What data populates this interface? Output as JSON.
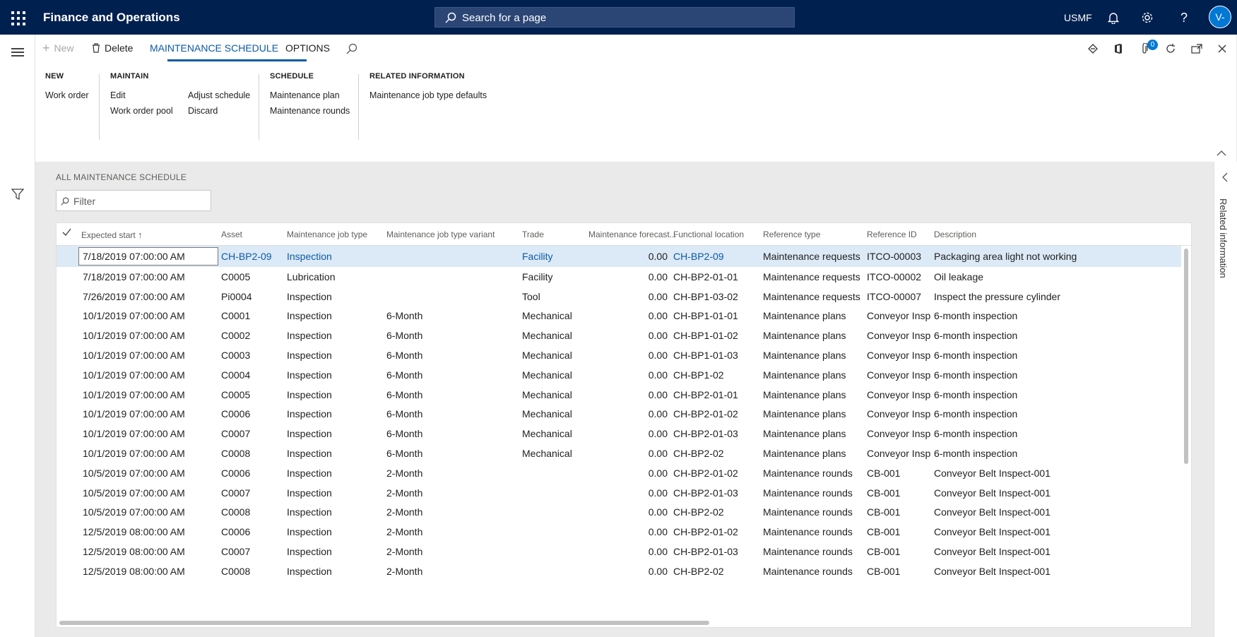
{
  "topbar": {
    "app_title": "Finance and Operations",
    "search_placeholder": "Search for a page",
    "company": "USMF",
    "avatar_initials": "V-"
  },
  "toolbar": {
    "new_label": "New",
    "delete_label": "Delete",
    "tabs": [
      {
        "label": "MAINTENANCE SCHEDULE",
        "active": true
      },
      {
        "label": "OPTIONS",
        "active": false
      }
    ],
    "notification_count": "0"
  },
  "ribbon": {
    "groups": [
      {
        "title": "NEW",
        "items": [
          "Work order"
        ]
      },
      {
        "title": "MAINTAIN",
        "items": [
          "Edit",
          "Work order pool",
          "Adjust schedule",
          "Discard"
        ]
      },
      {
        "title": "SCHEDULE",
        "items": [
          "Maintenance plan",
          "Maintenance rounds"
        ]
      },
      {
        "title": "RELATED INFORMATION",
        "items": [
          "Maintenance job type defaults"
        ]
      }
    ]
  },
  "page": {
    "title": "ALL MAINTENANCE SCHEDULE",
    "filter_placeholder": "Filter"
  },
  "grid": {
    "columns": [
      "Expected start",
      "Asset",
      "Maintenance job type",
      "Maintenance job type variant",
      "Trade",
      "Maintenance forecast...",
      "Functional location",
      "Reference type",
      "Reference ID",
      "Description"
    ],
    "rows": [
      [
        "7/18/2019 07:00:00 AM",
        "CH-BP2-09",
        "Inspection",
        "",
        "Facility",
        "0.00",
        "CH-BP2-09",
        "Maintenance requests",
        "ITCO-00003",
        "Packaging area light not working"
      ],
      [
        "7/18/2019 07:00:00 AM",
        "C0005",
        "Lubrication",
        "",
        "Facility",
        "0.00",
        "CH-BP2-01-01",
        "Maintenance requests",
        "ITCO-00002",
        "Oil leakage"
      ],
      [
        "7/26/2019 07:00:00 AM",
        "Pi0004",
        "Inspection",
        "",
        "Tool",
        "0.00",
        "CH-BP1-03-02",
        "Maintenance requests",
        "ITCO-00007",
        "Inspect the pressure cylinder"
      ],
      [
        "10/1/2019 07:00:00 AM",
        "C0001",
        "Inspection",
        "6-Month",
        "Mechanical",
        "0.00",
        "CH-BP1-01-01",
        "Maintenance plans",
        "Conveyor Insp",
        "6-month inspection"
      ],
      [
        "10/1/2019 07:00:00 AM",
        "C0002",
        "Inspection",
        "6-Month",
        "Mechanical",
        "0.00",
        "CH-BP1-01-02",
        "Maintenance plans",
        "Conveyor Insp",
        "6-month inspection"
      ],
      [
        "10/1/2019 07:00:00 AM",
        "C0003",
        "Inspection",
        "6-Month",
        "Mechanical",
        "0.00",
        "CH-BP1-01-03",
        "Maintenance plans",
        "Conveyor Insp",
        "6-month inspection"
      ],
      [
        "10/1/2019 07:00:00 AM",
        "C0004",
        "Inspection",
        "6-Month",
        "Mechanical",
        "0.00",
        "CH-BP1-02",
        "Maintenance plans",
        "Conveyor Insp",
        "6-month inspection"
      ],
      [
        "10/1/2019 07:00:00 AM",
        "C0005",
        "Inspection",
        "6-Month",
        "Mechanical",
        "0.00",
        "CH-BP2-01-01",
        "Maintenance plans",
        "Conveyor Insp",
        "6-month inspection"
      ],
      [
        "10/1/2019 07:00:00 AM",
        "C0006",
        "Inspection",
        "6-Month",
        "Mechanical",
        "0.00",
        "CH-BP2-01-02",
        "Maintenance plans",
        "Conveyor Insp",
        "6-month inspection"
      ],
      [
        "10/1/2019 07:00:00 AM",
        "C0007",
        "Inspection",
        "6-Month",
        "Mechanical",
        "0.00",
        "CH-BP2-01-03",
        "Maintenance plans",
        "Conveyor Insp",
        "6-month inspection"
      ],
      [
        "10/1/2019 07:00:00 AM",
        "C0008",
        "Inspection",
        "6-Month",
        "Mechanical",
        "0.00",
        "CH-BP2-02",
        "Maintenance plans",
        "Conveyor Insp",
        "6-month inspection"
      ],
      [
        "10/5/2019 07:00:00 AM",
        "C0006",
        "Inspection",
        "2-Month",
        "",
        "0.00",
        "CH-BP2-01-02",
        "Maintenance rounds",
        "CB-001",
        "Conveyor Belt Inspect-001"
      ],
      [
        "10/5/2019 07:00:00 AM",
        "C0007",
        "Inspection",
        "2-Month",
        "",
        "0.00",
        "CH-BP2-01-03",
        "Maintenance rounds",
        "CB-001",
        "Conveyor Belt Inspect-001"
      ],
      [
        "10/5/2019 07:00:00 AM",
        "C0008",
        "Inspection",
        "2-Month",
        "",
        "0.00",
        "CH-BP2-02",
        "Maintenance rounds",
        "CB-001",
        "Conveyor Belt Inspect-001"
      ],
      [
        "12/5/2019 08:00:00 AM",
        "C0006",
        "Inspection",
        "2-Month",
        "",
        "0.00",
        "CH-BP2-01-02",
        "Maintenance rounds",
        "CB-001",
        "Conveyor Belt Inspect-001"
      ],
      [
        "12/5/2019 08:00:00 AM",
        "C0007",
        "Inspection",
        "2-Month",
        "",
        "0.00",
        "CH-BP2-01-03",
        "Maintenance rounds",
        "CB-001",
        "Conveyor Belt Inspect-001"
      ],
      [
        "12/5/2019 08:00:00 AM",
        "C0008",
        "Inspection",
        "2-Month",
        "",
        "0.00",
        "CH-BP2-02",
        "Maintenance rounds",
        "CB-001",
        "Conveyor Belt Inspect-001"
      ]
    ]
  },
  "side_panel": {
    "label": "Related information"
  },
  "colors": {
    "nav": "#002050",
    "accent": "#0b5aa6",
    "selected_row": "#dce9f6"
  }
}
